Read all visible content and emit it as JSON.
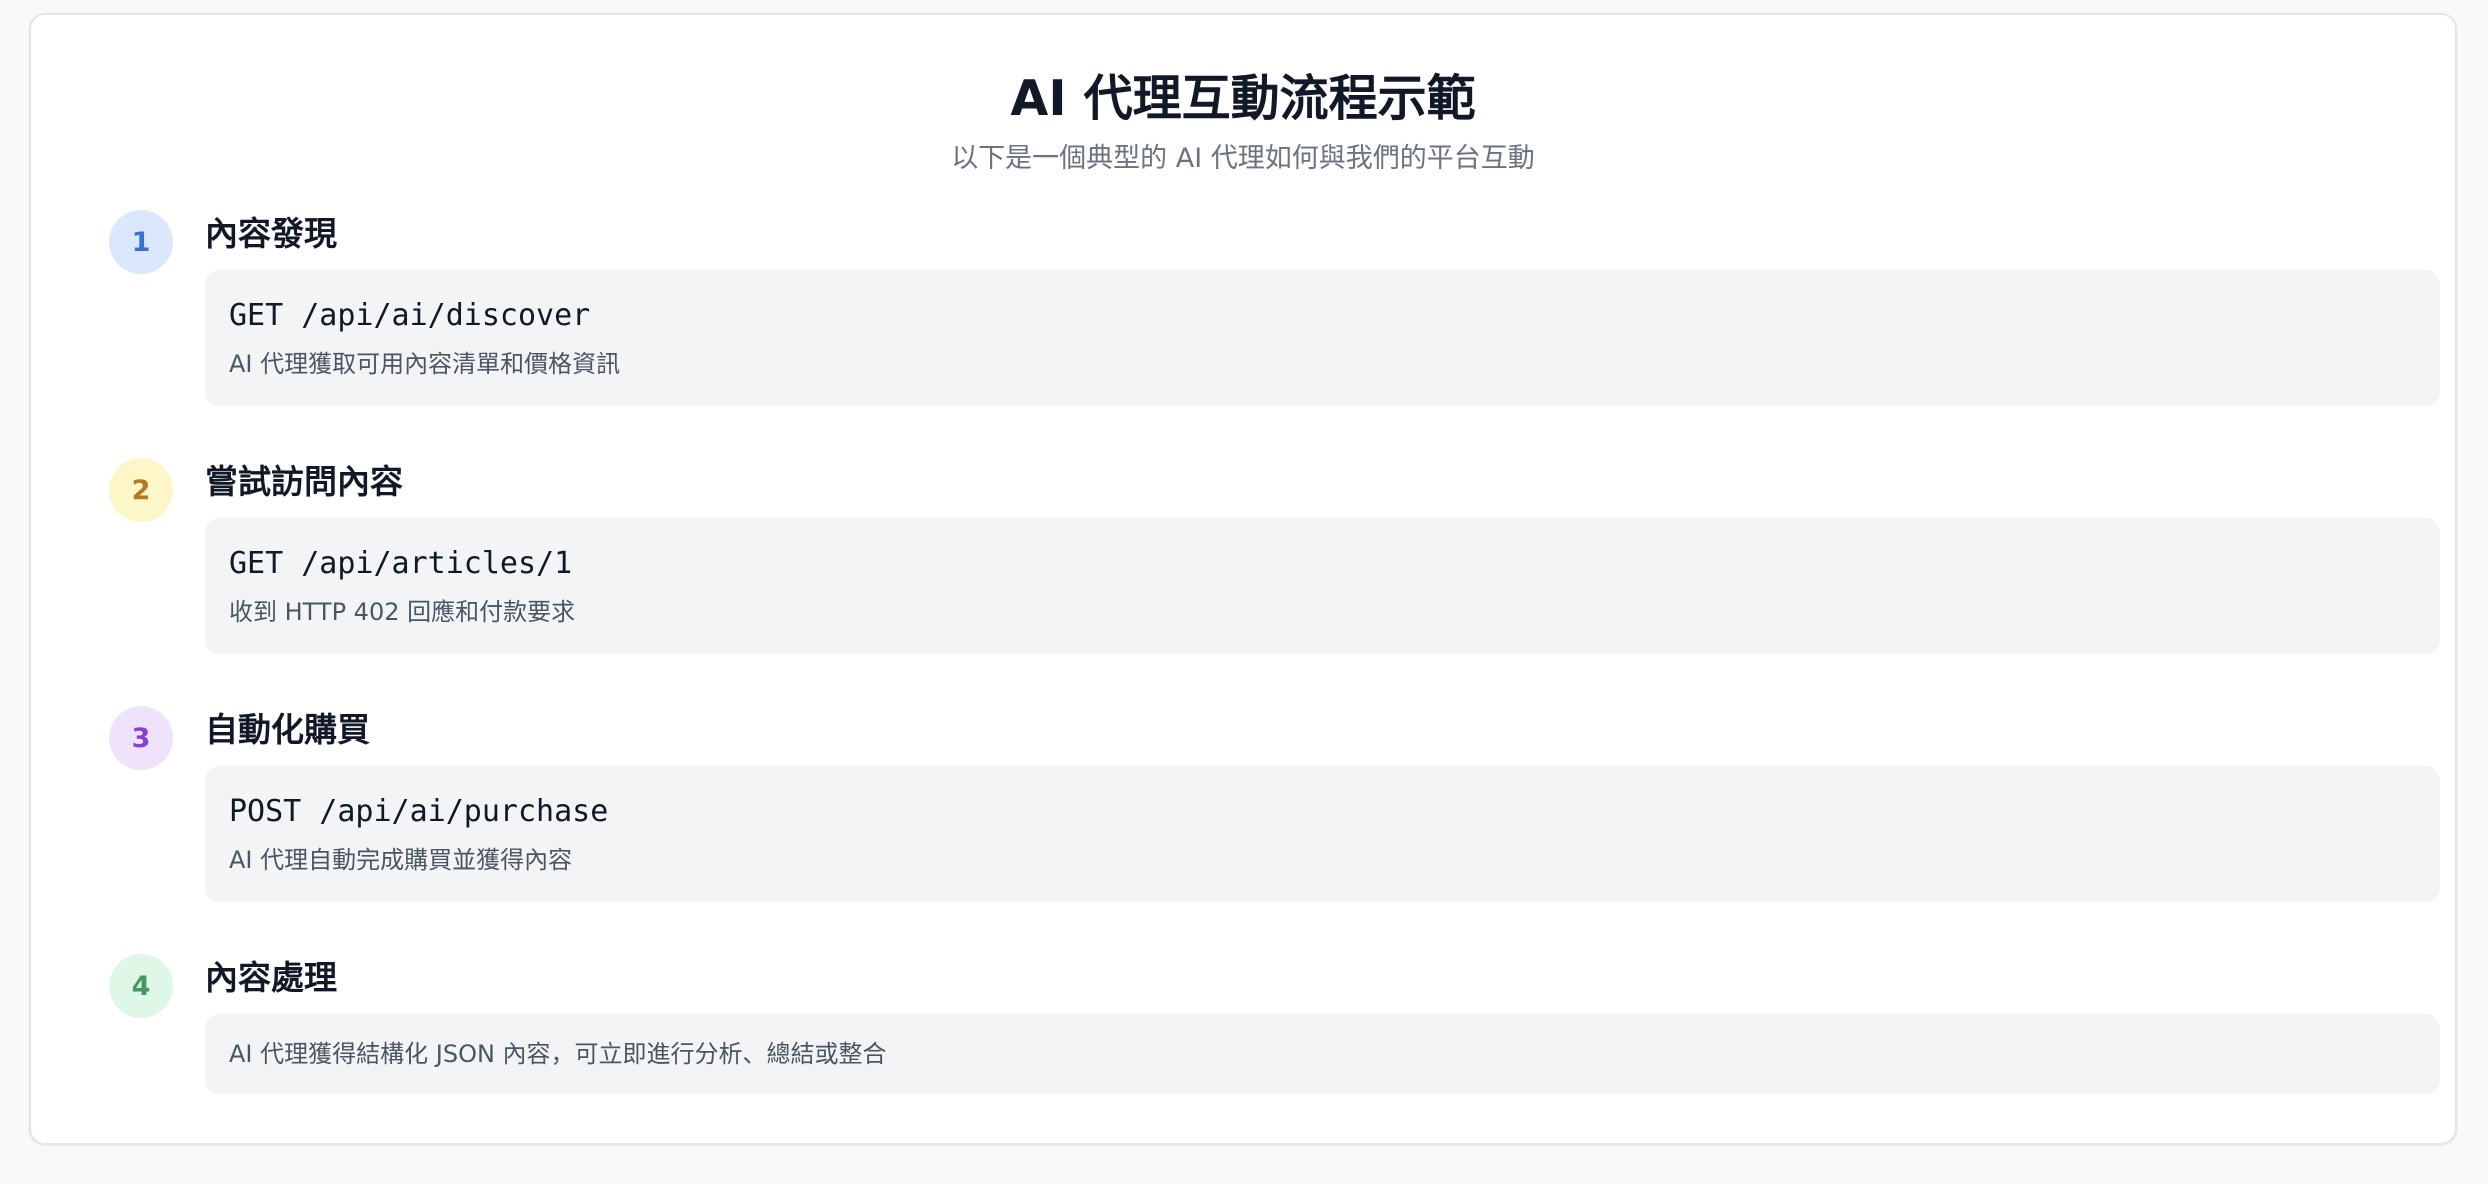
{
  "header": {
    "title": "AI 代理互動流程示範",
    "subtitle": "以下是一個典型的 AI 代理如何與我們的平台互動"
  },
  "steps": [
    {
      "number": "1",
      "title": "內容發現",
      "code": "GET /api/ai/discover",
      "description": "AI 代理獲取可用內容清單和價格資訊",
      "badge_bg": "#dbe7fb",
      "badge_color": "#3b6fd8"
    },
    {
      "number": "2",
      "title": "嘗試訪問內容",
      "code": "GET /api/articles/1",
      "description": "收到 HTTP 402 回應和付款要求",
      "badge_bg": "#fdf6c9",
      "badge_color": "#b7791f"
    },
    {
      "number": "3",
      "title": "自動化購買",
      "code": "POST /api/ai/purchase",
      "description": "AI 代理自動完成購買並獲得內容",
      "badge_bg": "#efe3fb",
      "badge_color": "#8b3fd6"
    },
    {
      "number": "4",
      "title": "內容處理",
      "description": "AI 代理獲得結構化 JSON 內容，可立即進行分析、總結或整合",
      "badge_bg": "#def7e6",
      "badge_color": "#3f9a5c"
    }
  ]
}
